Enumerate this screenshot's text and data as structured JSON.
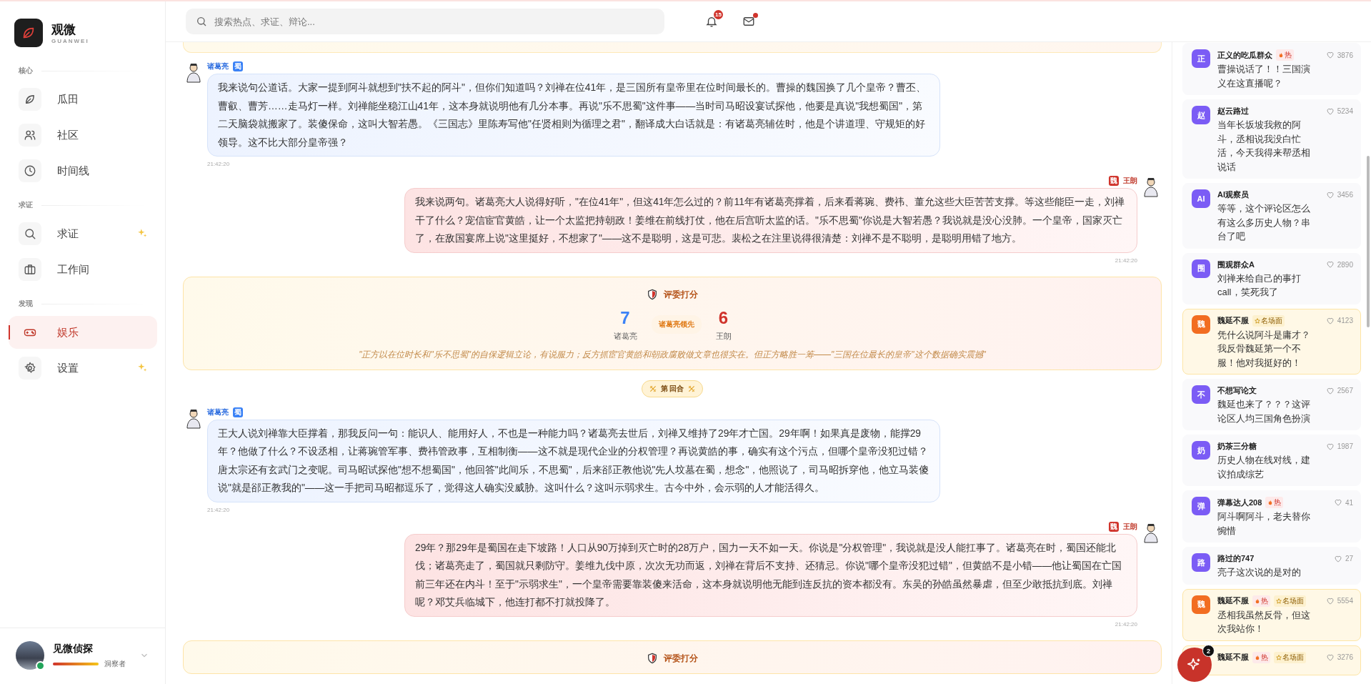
{
  "brand": {
    "name": "观微",
    "subtitle": "GUANWEI"
  },
  "nav": [
    {
      "section": "核心",
      "items": [
        {
          "label": "瓜田",
          "selected": false,
          "sparkle": false
        },
        {
          "label": "社区",
          "selected": false,
          "sparkle": false
        },
        {
          "label": "时间线",
          "selected": false,
          "sparkle": false
        }
      ]
    },
    {
      "section": "求证",
      "items": [
        {
          "label": "求证",
          "selected": false,
          "sparkle": true
        },
        {
          "label": "工作间",
          "selected": false,
          "sparkle": false
        }
      ]
    },
    {
      "section": "发现",
      "items": [
        {
          "label": "娱乐",
          "selected": true,
          "sparkle": false
        },
        {
          "label": "设置",
          "selected": false,
          "sparkle": true
        }
      ]
    }
  ],
  "user": {
    "name": "见微侦探",
    "level": 1,
    "rank": "洞察者",
    "online": true
  },
  "search": {
    "placeholder": "搜索热点、求证、辩论..."
  },
  "notifications": {
    "count": "15"
  },
  "mail": {
    "unread": true
  },
  "feed": [
    {
      "kind": "judge_end"
    },
    {
      "kind": "left_message",
      "speaker": "诸葛亮",
      "faction": "蜀",
      "text": "我来说句公道话。大家一提到阿斗就想到\"扶不起的阿斗\"，但你们知道吗？刘禅在位41年，是三国所有皇帝里在位时间最长的。曹操的魏国换了几个皇帝？曹丕、曹叡、曹芳……走马灯一样。刘禅能坐稳江山41年，这本身就说明他有几分本事。再说\"乐不思蜀\"这件事——当时司马昭设宴试探他，他要是真说\"我想蜀国\"，第二天脑袋就搬家了。装傻保命，这叫大智若愚。《三国志》里陈寿写他\"任贤相则为循理之君\"，翻译成大白话就是：有诸葛亮辅佐时，他是个讲道理、守规矩的好领导。这不比大部分皇帝强？",
      "time": "21:42:20"
    },
    {
      "kind": "right_message",
      "speaker": "王朗",
      "faction": "魏",
      "text": "我来说两句。诸葛亮大人说得好听，\"在位41年\"，但这41年怎么过的？前11年有诸葛亮撑着，后来看蒋琬、费祎、董允这些大臣苦苦支撑。等这些能臣一走，刘禅干了什么？宠信宦官黄皓，让一个太监把持朝政！姜维在前线打仗，他在后宫听太监的话。\"乐不思蜀\"你说是大智若愚？我说就是没心没肺。一个皇帝，国家灭亡了，在敌国宴席上说\"这里挺好，不想家了\"——这不是聪明，这是可悲。裴松之在注里说得很清楚：刘禅不是不聪明，是聪明用错了地方。",
      "time": "21:42:20"
    },
    {
      "kind": "judge",
      "title": "评委打分",
      "score_a": "7",
      "name_a": "诸葛亮",
      "lead": "诸葛亮领先",
      "score_b": "6",
      "name_b": "王朗",
      "comment": "\"正方以在位时长和\"乐不思蜀\"的自保逻辑立论，有说服力；反方抓宦官黄皓和朝政腐败做文章也很实在。但正方略胜一筹——\"三国在位最长的皇帝\"这个数据确实震撼\""
    },
    {
      "kind": "round",
      "label": "第 回合"
    },
    {
      "kind": "left_message",
      "speaker": "诸葛亮",
      "faction": "蜀",
      "text": "王大人说刘禅靠大臣撑着，那我反问一句：能识人、能用好人，不也是一种能力吗？诸葛亮去世后，刘禅又维持了29年才亡国。29年啊！如果真是废物，能撑29年？他做了什么？不设丞相，让蒋琬管军事、费祎管政事，互相制衡——这不就是现代企业的分权管理？再说黄皓的事，确实有这个污点，但哪个皇帝没犯过错？唐太宗还有玄武门之变呢。司马昭试探他\"想不想蜀国\"，他回答\"此间乐，不思蜀\"，后来郤正教他说\"先人坟墓在蜀，想念\"，他照说了，司马昭拆穿他，他立马装傻说\"就是郤正教我的\"——这一手把司马昭都逗乐了，觉得这人确实没威胁。这叫什么？这叫示弱求生。古今中外，会示弱的人才能活得久。",
      "time": "21:42:20"
    },
    {
      "kind": "right_message",
      "speaker": "王朗",
      "faction": "魏",
      "text": "29年？那29年是蜀国在走下坡路！人口从90万掉到灭亡时的28万户，国力一天不如一天。你说是\"分权管理\"，我说就是没人能扛事了。诸葛亮在时，蜀国还能北伐；诸葛亮走了，蜀国就只剩防守。姜维九伐中原，次次无功而返，刘禅在背后不支持、还猜忌。你说\"哪个皇帝没犯过错\"，但黄皓不是小错——他让蜀国在亡国前三年还在内斗！至于\"示弱求生\"，一个皇帝需要靠装傻来活命，这本身就说明他无能到连反抗的资本都没有。东吴的孙皓虽然暴虐，但至少敢抵抗到底。刘禅呢？邓艾兵临城下，他连打都不打就投降了。",
      "time": "21:42:20"
    },
    {
      "kind": "judge",
      "title": "评委打分"
    }
  ],
  "comments": [
    {
      "avatar": "正",
      "color": "#7b5cf5",
      "name": "正义的吃瓜群众",
      "tags": [
        {
          "kind": "hot",
          "label": "热"
        }
      ],
      "likes": "3876",
      "text": "曹操说话了！！三国演义在这直播呢？",
      "highlighted": false
    },
    {
      "avatar": "赵",
      "color": "#7b5cf5",
      "name": "赵云路过",
      "likes": "5234",
      "text": "当年长坂坡我救的阿斗，丞相说我没白忙活，今天我得来帮丞相说话",
      "highlighted": false
    },
    {
      "avatar": "AI",
      "color": "#7b5cf5",
      "name": "AI观察员",
      "likes": "3456",
      "text": "等等，这个评论区怎么有这么多历史人物？串台了吧",
      "highlighted": false
    },
    {
      "avatar": "围",
      "color": "#7b5cf5",
      "name": "围观群众A",
      "likes": "2890",
      "text": "刘禅来给自己的事打call，笑死我了",
      "highlighted": false
    },
    {
      "avatar": "魏",
      "color": "#f26d21",
      "name": "魏延不服",
      "tags": [
        {
          "kind": "famous",
          "label": "名场面"
        }
      ],
      "likes": "4123",
      "text": "凭什么说阿斗是庸才？我反骨魏延第一个不服！他对我挺好的！",
      "highlighted": true
    },
    {
      "avatar": "不",
      "color": "#7b5cf5",
      "name": "不想写论文",
      "likes": "2567",
      "text": "魏延也来了？？？这评论区人均三国角色扮演",
      "highlighted": false
    },
    {
      "avatar": "奶",
      "color": "#7b5cf5",
      "name": "奶茶三分糖",
      "likes": "1987",
      "text": "历史人物在线对线，建议拍成综艺",
      "highlighted": false
    },
    {
      "avatar": "弹",
      "color": "#7b5cf5",
      "name": "弹幕达人208",
      "tags": [
        {
          "kind": "hot",
          "label": "热"
        }
      ],
      "likes": "41",
      "text": "阿斗啊阿斗，老夫替你惋惜",
      "highlighted": false
    },
    {
      "avatar": "路",
      "color": "#7b5cf5",
      "name": "路过的747",
      "likes": "27",
      "text": "亮子这次说的是对的",
      "highlighted": false
    },
    {
      "avatar": "魏",
      "color": "#f26d21",
      "name": "魏延不服",
      "tags": [
        {
          "kind": "hot",
          "label": "热"
        },
        {
          "kind": "famous",
          "label": "名场面"
        }
      ],
      "likes": "5554",
      "text": "丞相我虽然反骨，但这次我站你！",
      "highlighted": true
    },
    {
      "name": "魏延不服",
      "tags": [
        {
          "kind": "hot",
          "label": "热"
        },
        {
          "kind": "famous",
          "label": "名场面"
        }
      ],
      "likes": "3276",
      "highlighted": true
    }
  ],
  "fab": {
    "badge": "2"
  }
}
